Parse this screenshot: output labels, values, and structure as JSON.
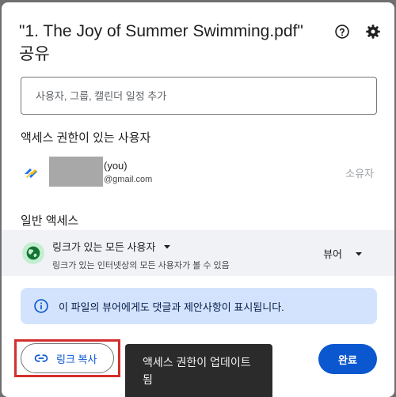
{
  "dialog": {
    "title": "\"1. The Joy of Summer Swimming.pdf\"",
    "subtitle": "공유",
    "help_icon": "help-circle-icon",
    "settings_icon": "gear-icon"
  },
  "add_people": {
    "placeholder": "사용자, 그룹, 캘린더 일정 추가",
    "value": ""
  },
  "people_section": {
    "title": "액세스 권한이 있는 사용자",
    "people": [
      {
        "name_suffix": "(you)",
        "email": "@gmail.com",
        "role": "소유자"
      }
    ]
  },
  "general_access": {
    "title": "일반 액세스",
    "access_label": "링크가 있는 모든 사용자",
    "description": "링크가 있는 인터넷상의 모든 사용자가 볼 수 있음",
    "role": "뷰어",
    "icon": "globe-icon"
  },
  "info_banner": {
    "text": "이 파일의 뷰어에게도 댓글과 제안사항이 표시됩니다.",
    "icon": "info-icon"
  },
  "footer": {
    "copy_link_label": "링크 복사",
    "copy_link_icon": "link-icon",
    "toast_text": "액세스 권한이 업데이트됨",
    "done_label": "완료"
  },
  "colors": {
    "primary": "#0b57d0",
    "banner_bg": "#d3e3fd",
    "highlight": "#d32f2f",
    "toast_bg": "#2b2b2b"
  }
}
